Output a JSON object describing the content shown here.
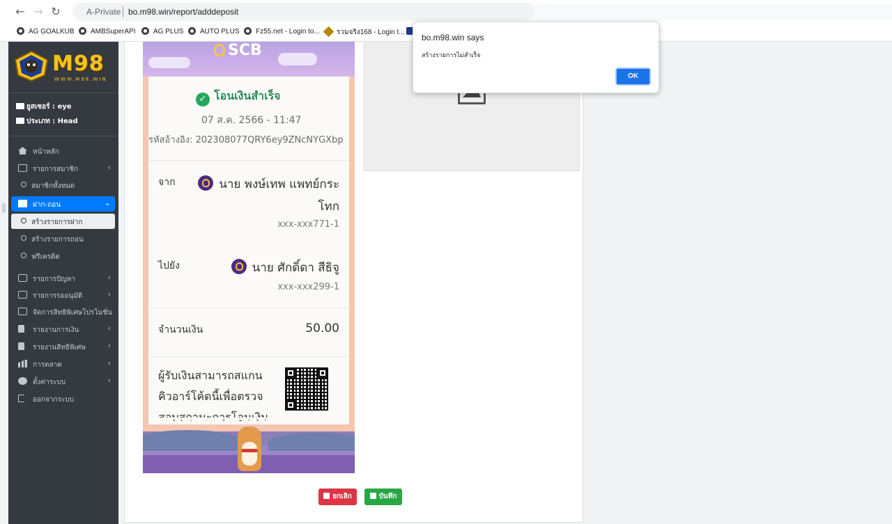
{
  "browser": {
    "private_label": "A-Private",
    "url": "bo.m98.win/report/adddeposit"
  },
  "bookmarks": [
    {
      "label": "AG GOALKUB",
      "icon": "globe-icon"
    },
    {
      "label": "AMBSuperAPI",
      "icon": "globe-icon"
    },
    {
      "label": "AG PLUS",
      "icon": "globe-icon"
    },
    {
      "label": "AUTO PLUS",
      "icon": "globe-icon"
    },
    {
      "label": "Fz55.net - Login to...",
      "icon": "globe-icon"
    },
    {
      "label": "รวมจริง168 - Login t...",
      "icon": "site-favicon"
    }
  ],
  "sidebar": {
    "logo_text": "M98",
    "logo_sub": "WWW.M98.WIN",
    "user_label": "ยูสเซอร์ : eye",
    "role_label": "ประเภท : Head",
    "items": [
      {
        "label": "หน้าหลัก",
        "icon": "home-icon"
      },
      {
        "label": "รายการสมาชิก",
        "icon": "id-card-icon"
      },
      {
        "label": "สมาชิกทั้งหมด",
        "icon": "circle-icon"
      },
      {
        "label": "ฝาก-ถอน",
        "icon": "box-icon"
      },
      {
        "label": "สร้างรายการฝาก",
        "icon": "circle-icon"
      },
      {
        "label": "สร้างรายการถอน",
        "icon": "circle-icon"
      },
      {
        "label": "ฟรีเครดิต",
        "icon": "circle-icon"
      },
      {
        "label": "รายการปัญหา",
        "icon": "money-icon"
      },
      {
        "label": "รายการรออนุมัติ",
        "icon": "money-icon"
      },
      {
        "label": "จัดการสิทธิพิเศษโปรโมชั่น",
        "icon": "money-icon"
      },
      {
        "label": "รายงานการเงิน",
        "icon": "file-icon"
      },
      {
        "label": "รายงานสิทธิพิเศษ",
        "icon": "file-icon"
      },
      {
        "label": "การตลาด",
        "icon": "chart-icon"
      },
      {
        "label": "ตั้งค่าระบบ",
        "icon": "gear-icon"
      },
      {
        "label": "ออกจากระบบ",
        "icon": "logout-icon"
      }
    ]
  },
  "slip": {
    "bank": "SCB",
    "status": "โอนเงินสำเร็จ",
    "datetime": "07 ส.ค. 2566 - 11:47",
    "ref": "รหัสอ้างอิง: 202308077QRY6ey9ZNcNYGXbp",
    "from_label": "จาก",
    "from_name_1": "นาย พงษ์เทพ แพทย์กระ",
    "from_name_2": "โทก",
    "from_acct": "xxx-xxx771-1",
    "to_label": "ไปยัง",
    "to_name": "นาย ศักดิ์ดา สีธิจู",
    "to_acct": "xxx-xxx299-1",
    "amount_label": "จำนวนเงิน",
    "amount": "50.00",
    "qr_line_1": "ผู้รับเงินสามารถสแกน",
    "qr_line_2": "คิวอาร์โค้ดนี้เพื่อตรวจ",
    "qr_line_3": "สอบสถานะการโอนเงิน"
  },
  "actions": {
    "cancel_label": "ยกเลิก",
    "save_label": "บันทึก"
  },
  "dialog": {
    "title": "bo.m98.win says",
    "message": "สร้างรายการไม่สำเร็จ",
    "ok_label": "OK"
  },
  "colors": {
    "sidebar_bg": "#343a40",
    "active_blue": "#007bff",
    "danger": "#dc3545",
    "success": "#28a745",
    "dialog_ok": "#1a73e8"
  }
}
